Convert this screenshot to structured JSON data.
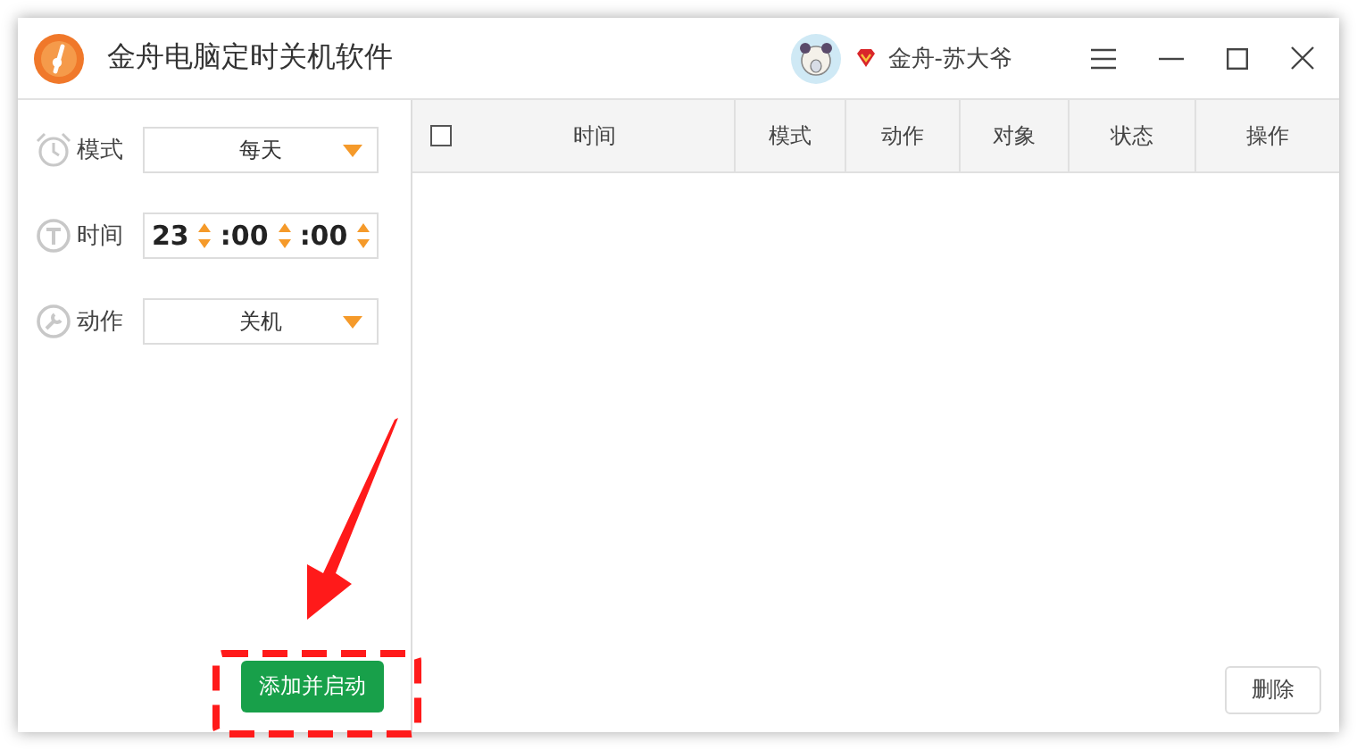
{
  "window": {
    "title": "金舟电脑定时关机软件",
    "user": "金舟-苏大爷"
  },
  "form": [
    {
      "kind": "select",
      "label": "模式",
      "value": "每天"
    },
    {
      "kind": "time",
      "label": "时间",
      "parts": [
        "23",
        ":00",
        ":00"
      ]
    },
    {
      "kind": "select",
      "label": "动作",
      "value": "关机"
    }
  ],
  "table": {
    "select_all": {
      "checked": false
    },
    "columns": [
      "时间",
      "模式",
      "动作",
      "对象",
      "状态",
      "操作"
    ]
  },
  "buttons": {
    "add": "添加并启动",
    "delete": "删除"
  }
}
